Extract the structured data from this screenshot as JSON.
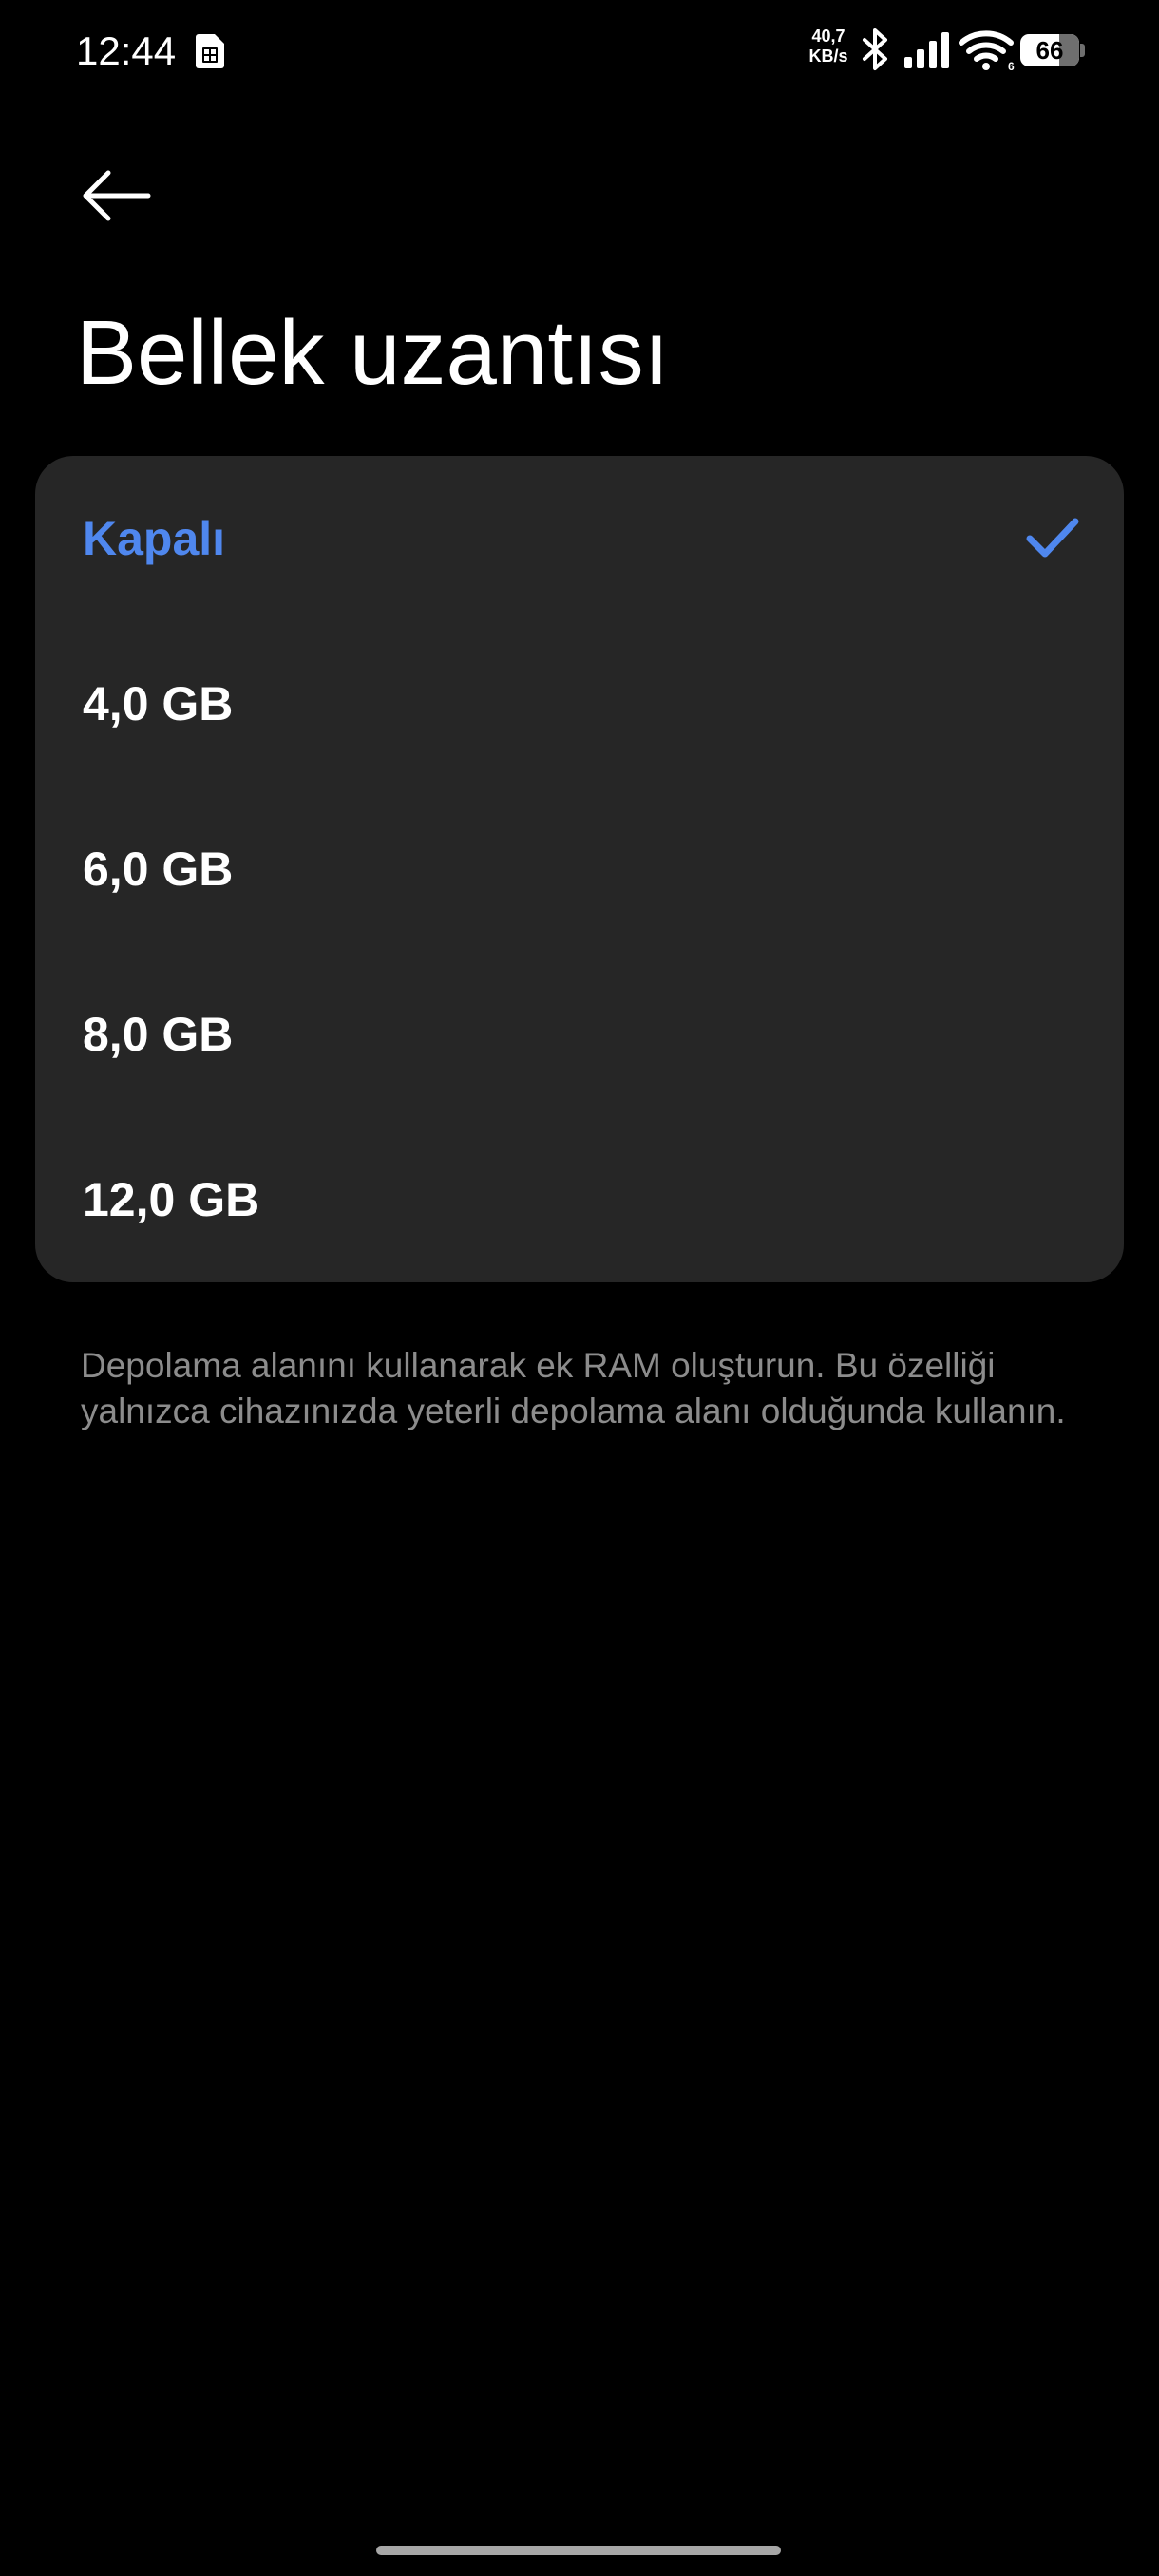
{
  "status_bar": {
    "time": "12:44",
    "net_speed_value": "40,7",
    "net_speed_unit": "KB/s",
    "battery_level": "66",
    "battery_fraction": 0.66,
    "icons": [
      "sim-card-icon",
      "bluetooth-icon",
      "cellular-signal-icon",
      "wifi-icon",
      "battery-icon"
    ]
  },
  "header": {
    "back_icon": "arrow-left-icon",
    "title": "Bellek uzantısı"
  },
  "options": [
    {
      "label": "Kapalı",
      "selected": true
    },
    {
      "label": "4,0 GB",
      "selected": false
    },
    {
      "label": "6,0 GB",
      "selected": false
    },
    {
      "label": "8,0 GB",
      "selected": false
    },
    {
      "label": "12,0 GB",
      "selected": false
    }
  ],
  "selected_icon": "checkmark-icon",
  "footer_note": "Depolama alanını kullanarak ek RAM oluşturun. Bu özelliği yalnızca cihazınızda yeterli depolama alanı olduğunda kullanın.",
  "colors": {
    "background": "#000000",
    "card": "#262626",
    "accent": "#4f87ee",
    "text_primary": "#ffffff",
    "text_secondary": "#8c8c8c"
  }
}
